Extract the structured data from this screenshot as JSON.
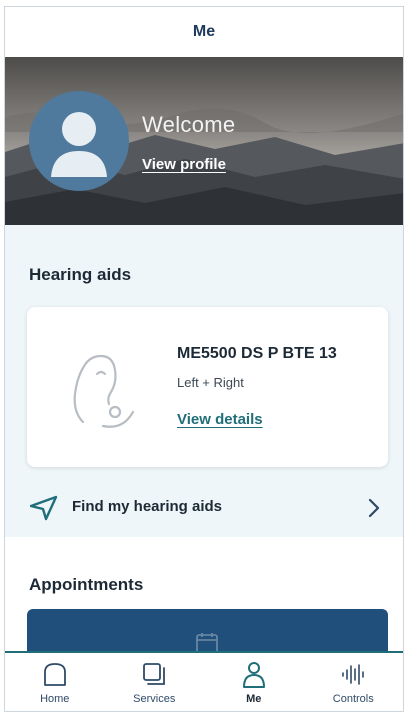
{
  "header": {
    "title": "Me"
  },
  "profile": {
    "welcome": "Welcome",
    "view_profile": "View profile"
  },
  "hearing_aids": {
    "title": "Hearing aids",
    "device": {
      "model": "ME5500 DS P BTE 13",
      "side": "Left + Right",
      "details_link": "View details"
    },
    "find": {
      "label": "Find my hearing aids",
      "icon": "location-arrow-icon"
    }
  },
  "appointments": {
    "title": "Appointments"
  },
  "tabs": [
    {
      "label": "Home",
      "icon": "home-icon"
    },
    {
      "label": "Services",
      "icon": "services-icon"
    },
    {
      "label": "Me",
      "icon": "person-icon",
      "active": true
    },
    {
      "label": "Controls",
      "icon": "controls-icon"
    }
  ],
  "colors": {
    "accent": "#1f6e79",
    "navy": "#1f4f7a",
    "light_bg": "#eef6f9"
  }
}
